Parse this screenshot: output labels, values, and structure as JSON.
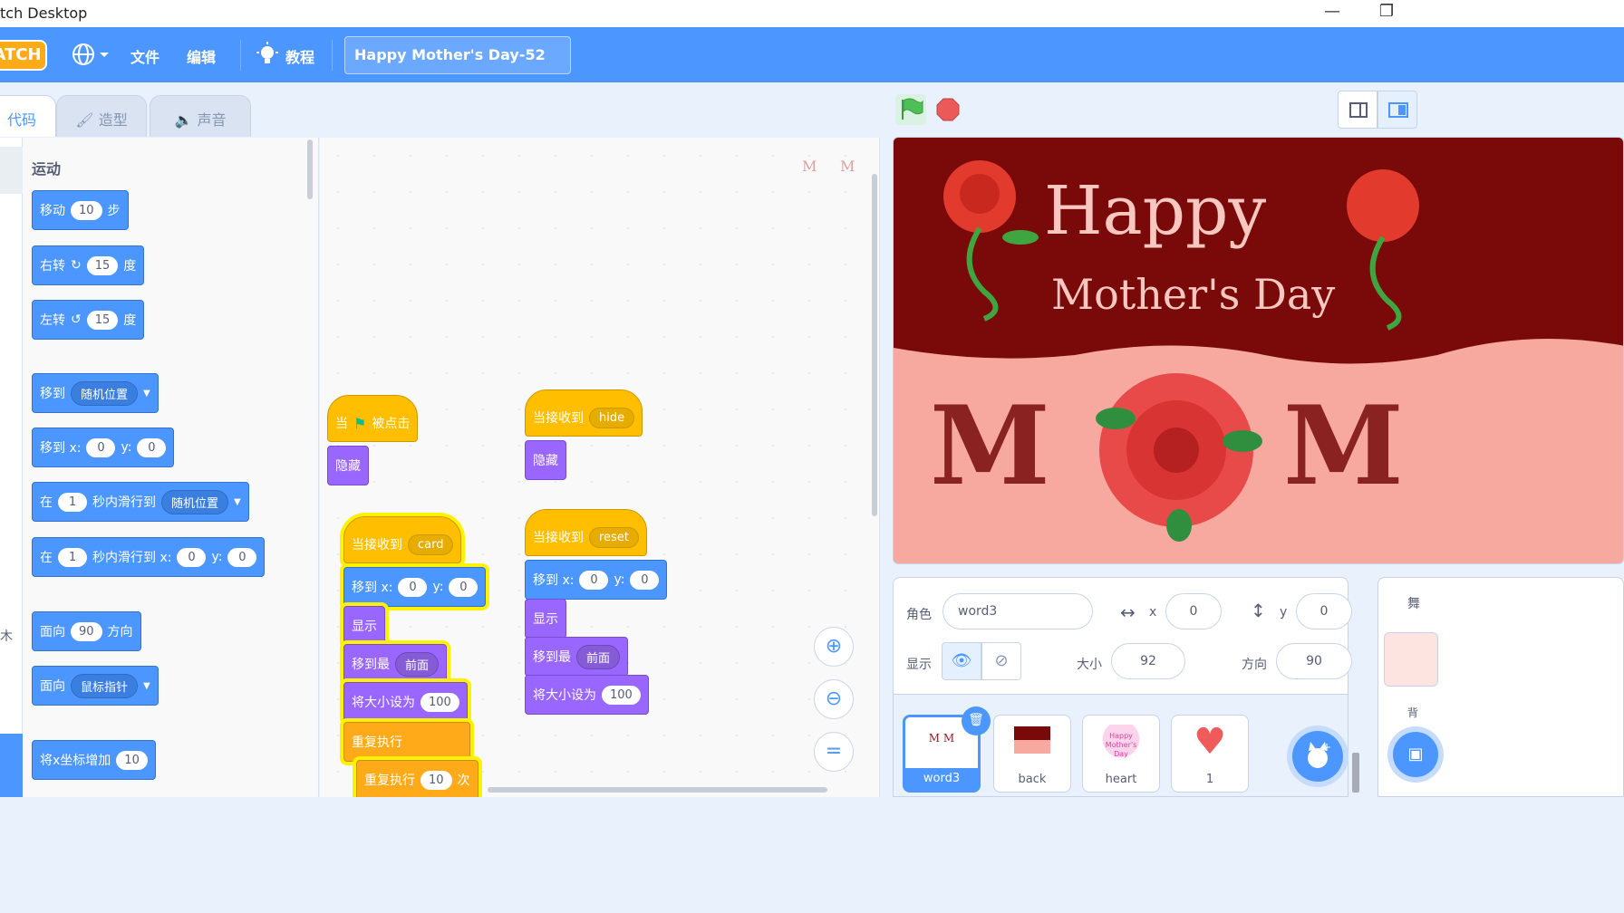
{
  "window": {
    "title": "tch Desktop",
    "minimize": "—",
    "restore": "❐"
  },
  "menubar": {
    "logo": "ATCH",
    "file": "文件",
    "edit": "编辑",
    "tutorials": "教程",
    "project_title": "Happy Mother's Day-52"
  },
  "tabs": {
    "code": "代码",
    "costumes": "造型",
    "sounds": "声音"
  },
  "palette": {
    "category_title": "运动",
    "side_char": "木",
    "blocks": {
      "move": [
        "移动",
        "10",
        "步"
      ],
      "turn_right": [
        "右转",
        "15",
        "度"
      ],
      "turn_left": [
        "左转",
        "15",
        "度"
      ],
      "goto": [
        "移到",
        "随机位置"
      ],
      "goto_xy": [
        "移到 x:",
        "0",
        "y:",
        "0"
      ],
      "glide": [
        "在",
        "1",
        "秒内滑行到",
        "随机位置"
      ],
      "glide_xy": [
        "在",
        "1",
        "秒内滑行到 x:",
        "0",
        "y:",
        "0"
      ],
      "point_dir": [
        "面向",
        "90",
        "方向"
      ],
      "point_towards": [
        "面向",
        "鼠标指针"
      ],
      "change_x": [
        "将x坐标增加",
        "10"
      ]
    }
  },
  "scripts": {
    "s1": {
      "hat": [
        "当",
        "被点击"
      ],
      "hide": "隐藏"
    },
    "s2": {
      "hat": [
        "当接收到",
        "hide"
      ],
      "hide": "隐藏"
    },
    "s3": {
      "hat": [
        "当接收到",
        "card"
      ],
      "goto": [
        "移到 x:",
        "0",
        "y:",
        "0"
      ],
      "show": "显示",
      "front": [
        "移到最",
        "前面"
      ],
      "size": [
        "将大小设为",
        "100"
      ],
      "forever": "重复执行",
      "repeat": [
        "重复执行",
        "10",
        "次"
      ]
    },
    "s4": {
      "hat": [
        "当接收到",
        "reset"
      ],
      "goto": [
        "移到 x:",
        "0",
        "y:",
        "0"
      ],
      "show": "显示",
      "front": [
        "移到最",
        "前面"
      ],
      "size": [
        "将大小设为",
        "100"
      ]
    },
    "preview_marks": [
      "M",
      "M"
    ]
  },
  "stage": {
    "happy": "Happy",
    "mothers_day": "Mother's Day",
    "mom_left": "M",
    "mom_right": "M"
  },
  "sprite_info": {
    "sprite_label": "角色",
    "sprite_name": "word3",
    "x_label": "x",
    "x_value": "0",
    "y_label": "y",
    "y_value": "0",
    "show_label": "显示",
    "size_label": "大小",
    "size_value": "92",
    "direction_label": "方向",
    "direction_value": "90"
  },
  "sprites": [
    {
      "name": "word3",
      "thumb": "M  M"
    },
    {
      "name": "back",
      "thumb": ""
    },
    {
      "name": "heart",
      "thumb": "Happy Mother's Day"
    },
    {
      "name": "1",
      "thumb": ""
    }
  ],
  "stage_panel": {
    "label": "舞",
    "backdrop_label": "背"
  },
  "colors": {
    "accent": "#4c97ff",
    "motion": "#4c97ff",
    "looks": "#9966ff",
    "events": "#ffbf00",
    "control": "#ffab19"
  }
}
